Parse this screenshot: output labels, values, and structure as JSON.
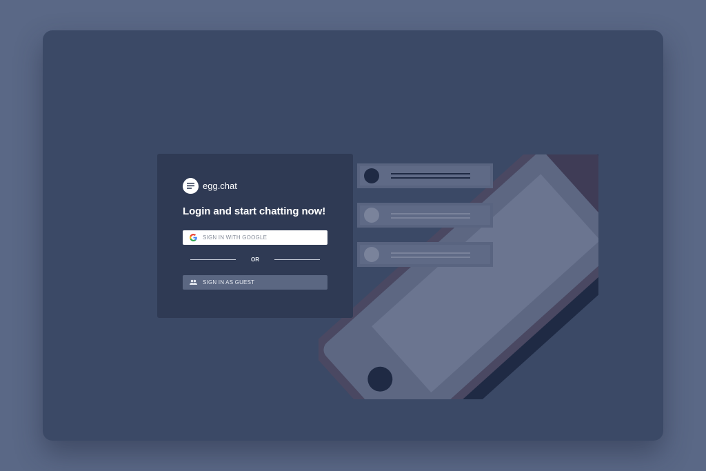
{
  "brand": {
    "name": "egg.chat"
  },
  "login": {
    "headline": "Login and start chatting now!",
    "google_button_label": "SIGN IN WITH GOOGLE",
    "divider_label": "OR",
    "guest_button_label": "SIGN IN AS GUEST"
  },
  "icons": {
    "brand_logo": "egg-chat-logo-icon",
    "google": "google-g-icon",
    "guest": "people-icon"
  },
  "colors": {
    "page_background": "#5a6886",
    "window_background": "#3b4966",
    "card_background": "#2f3a54",
    "google_button": "#ffffff",
    "guest_button": "#5b6782"
  }
}
